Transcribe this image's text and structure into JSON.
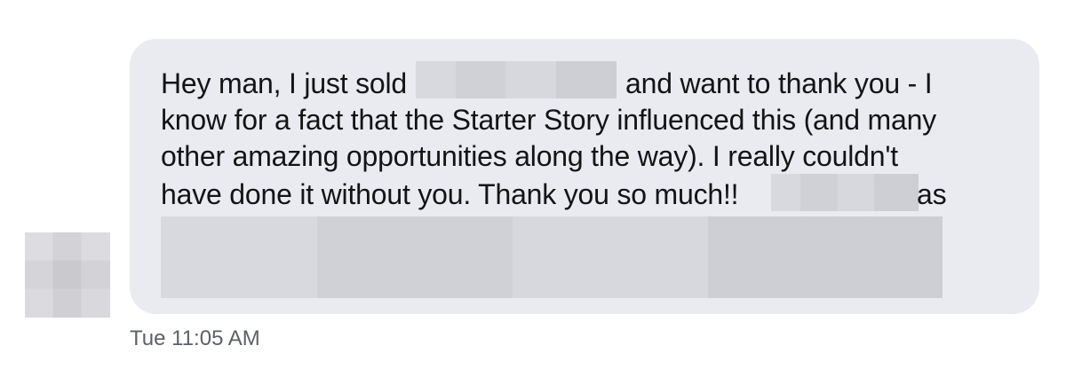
{
  "conversation": {
    "contact_avatar": "redacted",
    "message": {
      "line1_start": "Hey man, I just sold",
      "line1_end": "and want to thank you - I",
      "line2": "know for a fact that the Starter Story influenced this (and many",
      "line3": "other amazing opportunities along the way). I really couldn't",
      "line4_start": "have done it without you. Thank you so much!!",
      "line4_end": "as"
    },
    "timestamp": "Tue 11:05 AM"
  }
}
